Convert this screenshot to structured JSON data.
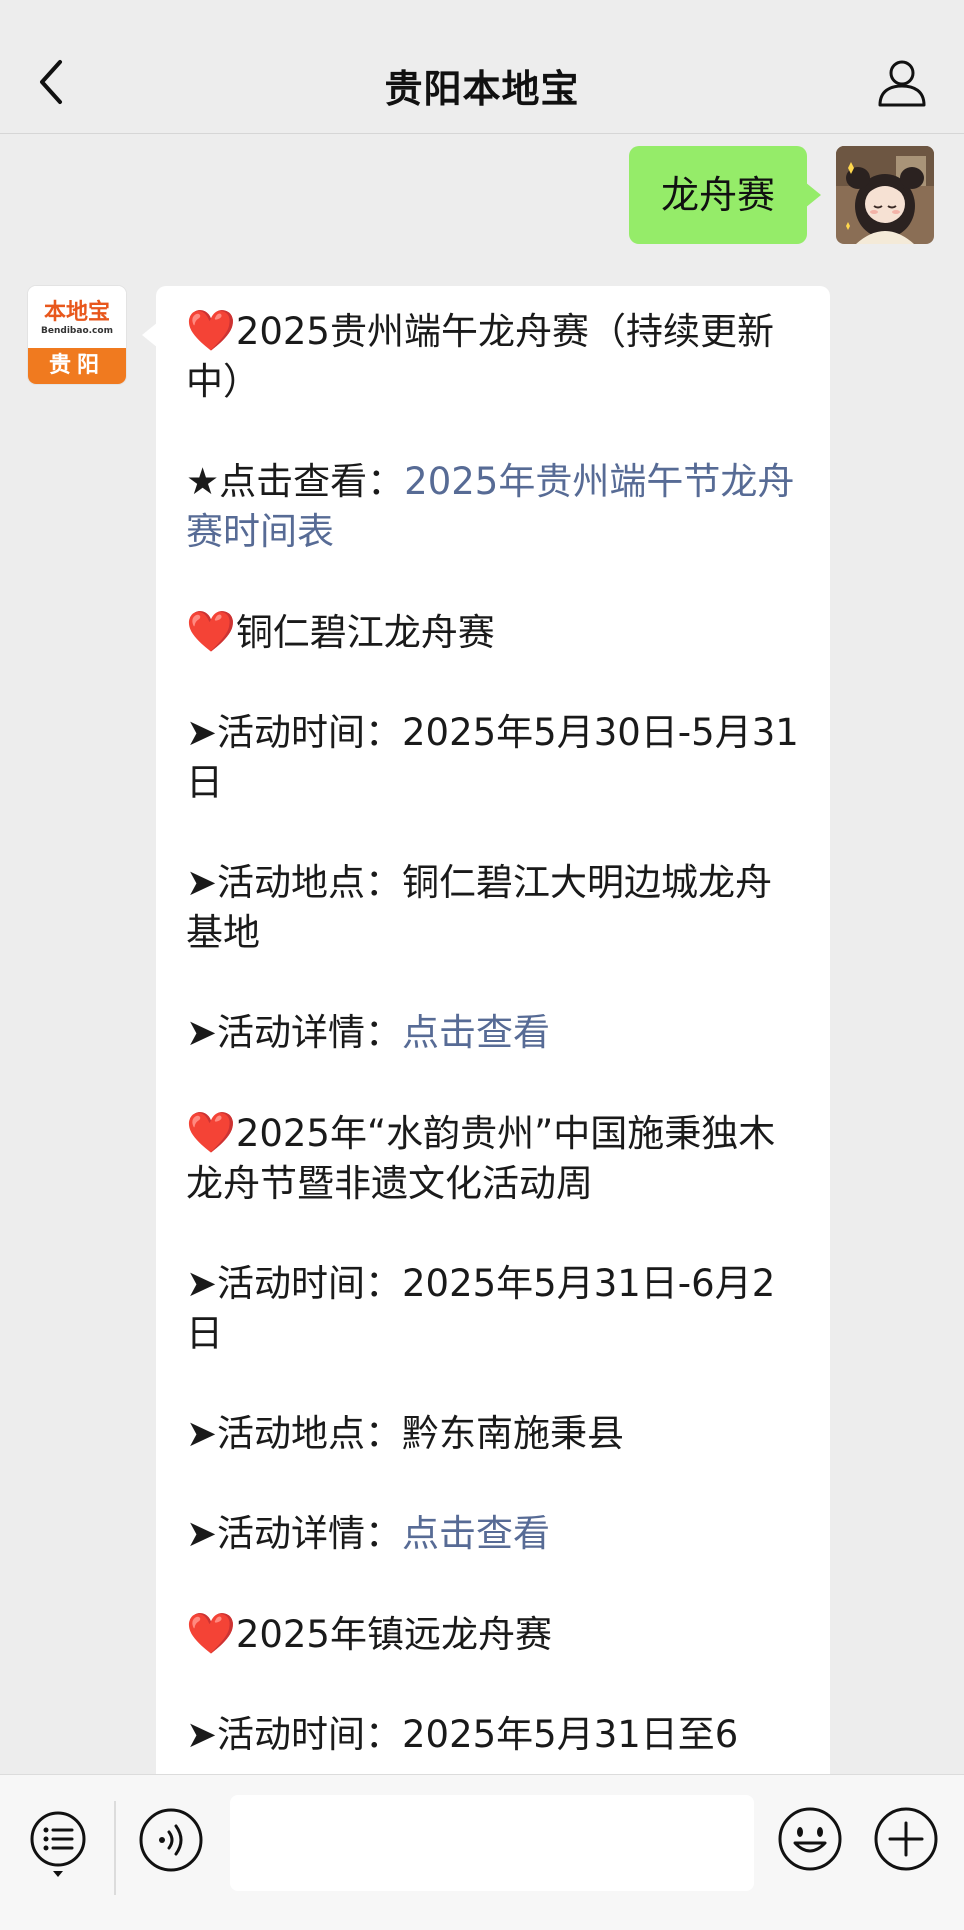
{
  "header": {
    "title": "贵阳本地宝"
  },
  "outgoing_message": {
    "text": "龙舟赛"
  },
  "bot_avatar": {
    "logo_text": "本地宝",
    "logo_sub": "Bendibao.com",
    "logo_city": "贵阳"
  },
  "incoming_message": {
    "heading1": "2025贵州端午龙舟赛（持续更新中）",
    "star_prefix": "★点击查看：",
    "star_link": "2025年贵州端午节龙舟赛时间表",
    "event1": {
      "title": "铜仁碧江龙舟赛",
      "time_label": "➤活动时间：",
      "time": "2025年5月30日-5月31日",
      "place_label": "➤活动地点：",
      "place": "铜仁碧江大明边城龙舟基地",
      "detail_label": "➤活动详情：",
      "detail_link": "点击查看"
    },
    "event2": {
      "title": "2025年“水韵贵州”中国施秉独木龙舟节暨非遗文化活动周",
      "time_label": "➤活动时间：",
      "time": "2025年5月31日-6月2日",
      "place_label": "➤活动地点：",
      "place": "黔东南施秉县",
      "detail_label": "➤活动详情：",
      "detail_link": "点击查看"
    },
    "event3": {
      "title": "2025年镇远龙舟赛",
      "time_label": "➤活动时间：",
      "time": "2025年5月31日至6"
    },
    "heart_glyph": "❤️"
  },
  "input_bar": {
    "placeholder": ""
  },
  "colors": {
    "background": "#ededed",
    "outgoing_bubble": "#95ec69",
    "incoming_bubble": "#ffffff",
    "link": "#576b95",
    "heart": "#e4171f",
    "logo_orange": "#f07a1f"
  }
}
